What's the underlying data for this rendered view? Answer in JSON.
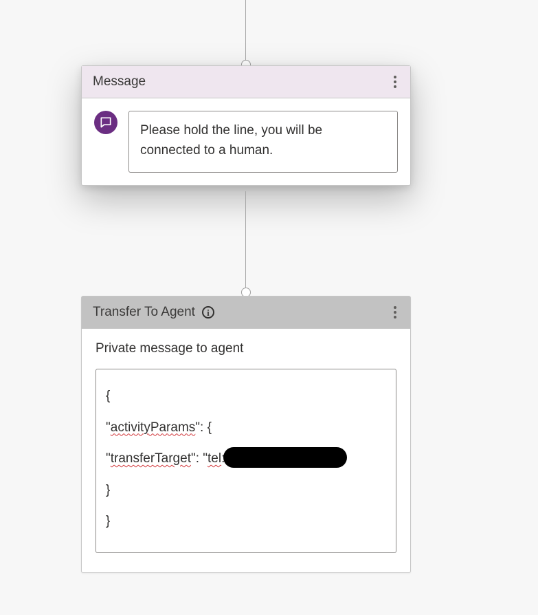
{
  "message_node": {
    "title": "Message",
    "text": "Please hold the line, you will be connected to a human."
  },
  "transfer_node": {
    "title": "Transfer To Agent",
    "field_label": "Private message to agent",
    "code": {
      "l1": "{",
      "l2_q1": "\"",
      "l2_key": "activityParams",
      "l2_q2": "\": {",
      "l3_q1": "\"",
      "l3_key": "transferTarget",
      "l3_q2": "\": \"",
      "l3_proto": "tel",
      "l3_colon": ":",
      "l4": "}",
      "l5": "}"
    }
  }
}
